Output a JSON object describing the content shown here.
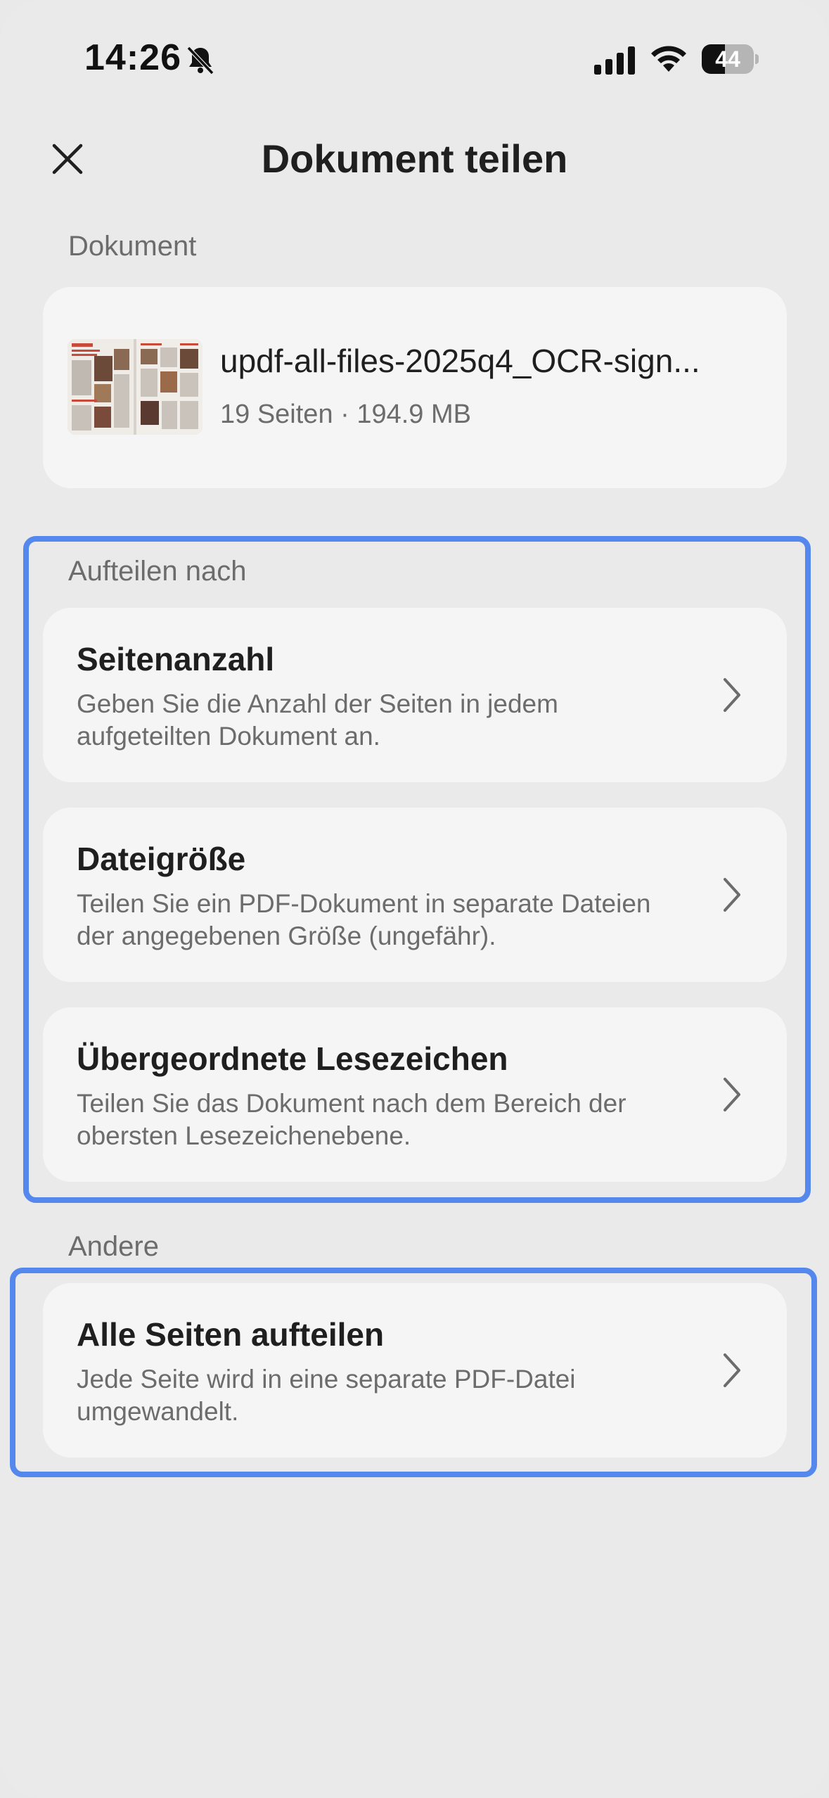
{
  "status_bar": {
    "time": "14:26",
    "battery_level": "44",
    "battery_fraction": 0.44,
    "icons": [
      "bell-slash-icon",
      "cellular-signal-icon",
      "wifi-icon",
      "battery-icon"
    ]
  },
  "header": {
    "title": "Dokument teilen",
    "close_icon": "close-icon"
  },
  "document_section": {
    "label": "Dokument",
    "file_name": "updf-all-files-2025q4_OCR-sign...",
    "meta": "19 Seiten · 194.9 MB"
  },
  "split_by_section": {
    "label": "Aufteilen nach",
    "options": [
      {
        "title": "Seitenanzahl",
        "description": "Geben Sie die Anzahl der Seiten in jedem aufgeteilten Dokument an."
      },
      {
        "title": "Dateigröße",
        "description": "Teilen Sie ein PDF-Dokument in separate Dateien der angegebenen Größe (ungefähr)."
      },
      {
        "title": "Übergeordnete Lesezeichen",
        "description": "Teilen Sie das Dokument nach dem Bereich der obersten Lesezeichenebene."
      }
    ]
  },
  "other_section": {
    "label": "Andere",
    "options": [
      {
        "title": "Alle Seiten aufteilen",
        "description": "Jede Seite wird in eine separate PDF-Datei umgewandelt."
      }
    ]
  },
  "colors": {
    "background": "#eaeaea",
    "card": "#f5f5f5",
    "highlight": "#5588ec",
    "text_primary": "#1f1f1f",
    "text_secondary": "#6c6c6c"
  }
}
